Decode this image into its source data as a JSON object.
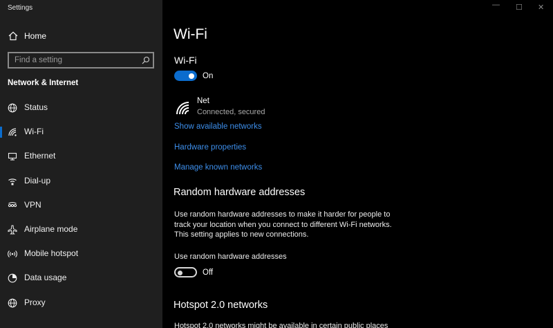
{
  "window": {
    "title": "Settings",
    "controls": {
      "minimize": "—",
      "maximize": "☐",
      "close": "✕"
    }
  },
  "sidebar": {
    "home_label": "Home",
    "search_placeholder": "Find a setting",
    "section_title": "Network & Internet",
    "items": [
      {
        "label": "Status",
        "icon": "globe-icon",
        "active": false
      },
      {
        "label": "Wi-Fi",
        "icon": "wifi-icon",
        "active": true
      },
      {
        "label": "Ethernet",
        "icon": "ethernet-icon",
        "active": false
      },
      {
        "label": "Dial-up",
        "icon": "dialup-icon",
        "active": false
      },
      {
        "label": "VPN",
        "icon": "vpn-icon",
        "active": false
      },
      {
        "label": "Airplane mode",
        "icon": "airplane-icon",
        "active": false
      },
      {
        "label": "Mobile hotspot",
        "icon": "hotspot-icon",
        "active": false
      },
      {
        "label": "Data usage",
        "icon": "data-usage-icon",
        "active": false
      },
      {
        "label": "Proxy",
        "icon": "globe-icon",
        "active": false
      }
    ]
  },
  "main": {
    "page_title": "Wi-Fi",
    "wifi_section": {
      "title": "Wi-Fi",
      "toggle_state": "On"
    },
    "network": {
      "name": "Net",
      "status": "Connected, secured"
    },
    "links": {
      "show_available": "Show available networks",
      "hardware_properties": "Hardware properties",
      "manage_known": "Manage known networks"
    },
    "random_hw": {
      "title": "Random hardware addresses",
      "description": "Use random hardware addresses to make it harder for people to track your location when you connect to different Wi-Fi networks. This setting applies to new connections.",
      "option_label": "Use random hardware addresses",
      "toggle_state": "Off"
    },
    "hotspot": {
      "title": "Hotspot 2.0 networks",
      "description": "Hotspot 2.0 networks might be available in certain public places"
    }
  },
  "colors": {
    "sidebar_bg": "#1f1f1f",
    "main_bg": "#000000",
    "accent": "#0b6ccd",
    "link": "#3d8eea"
  }
}
